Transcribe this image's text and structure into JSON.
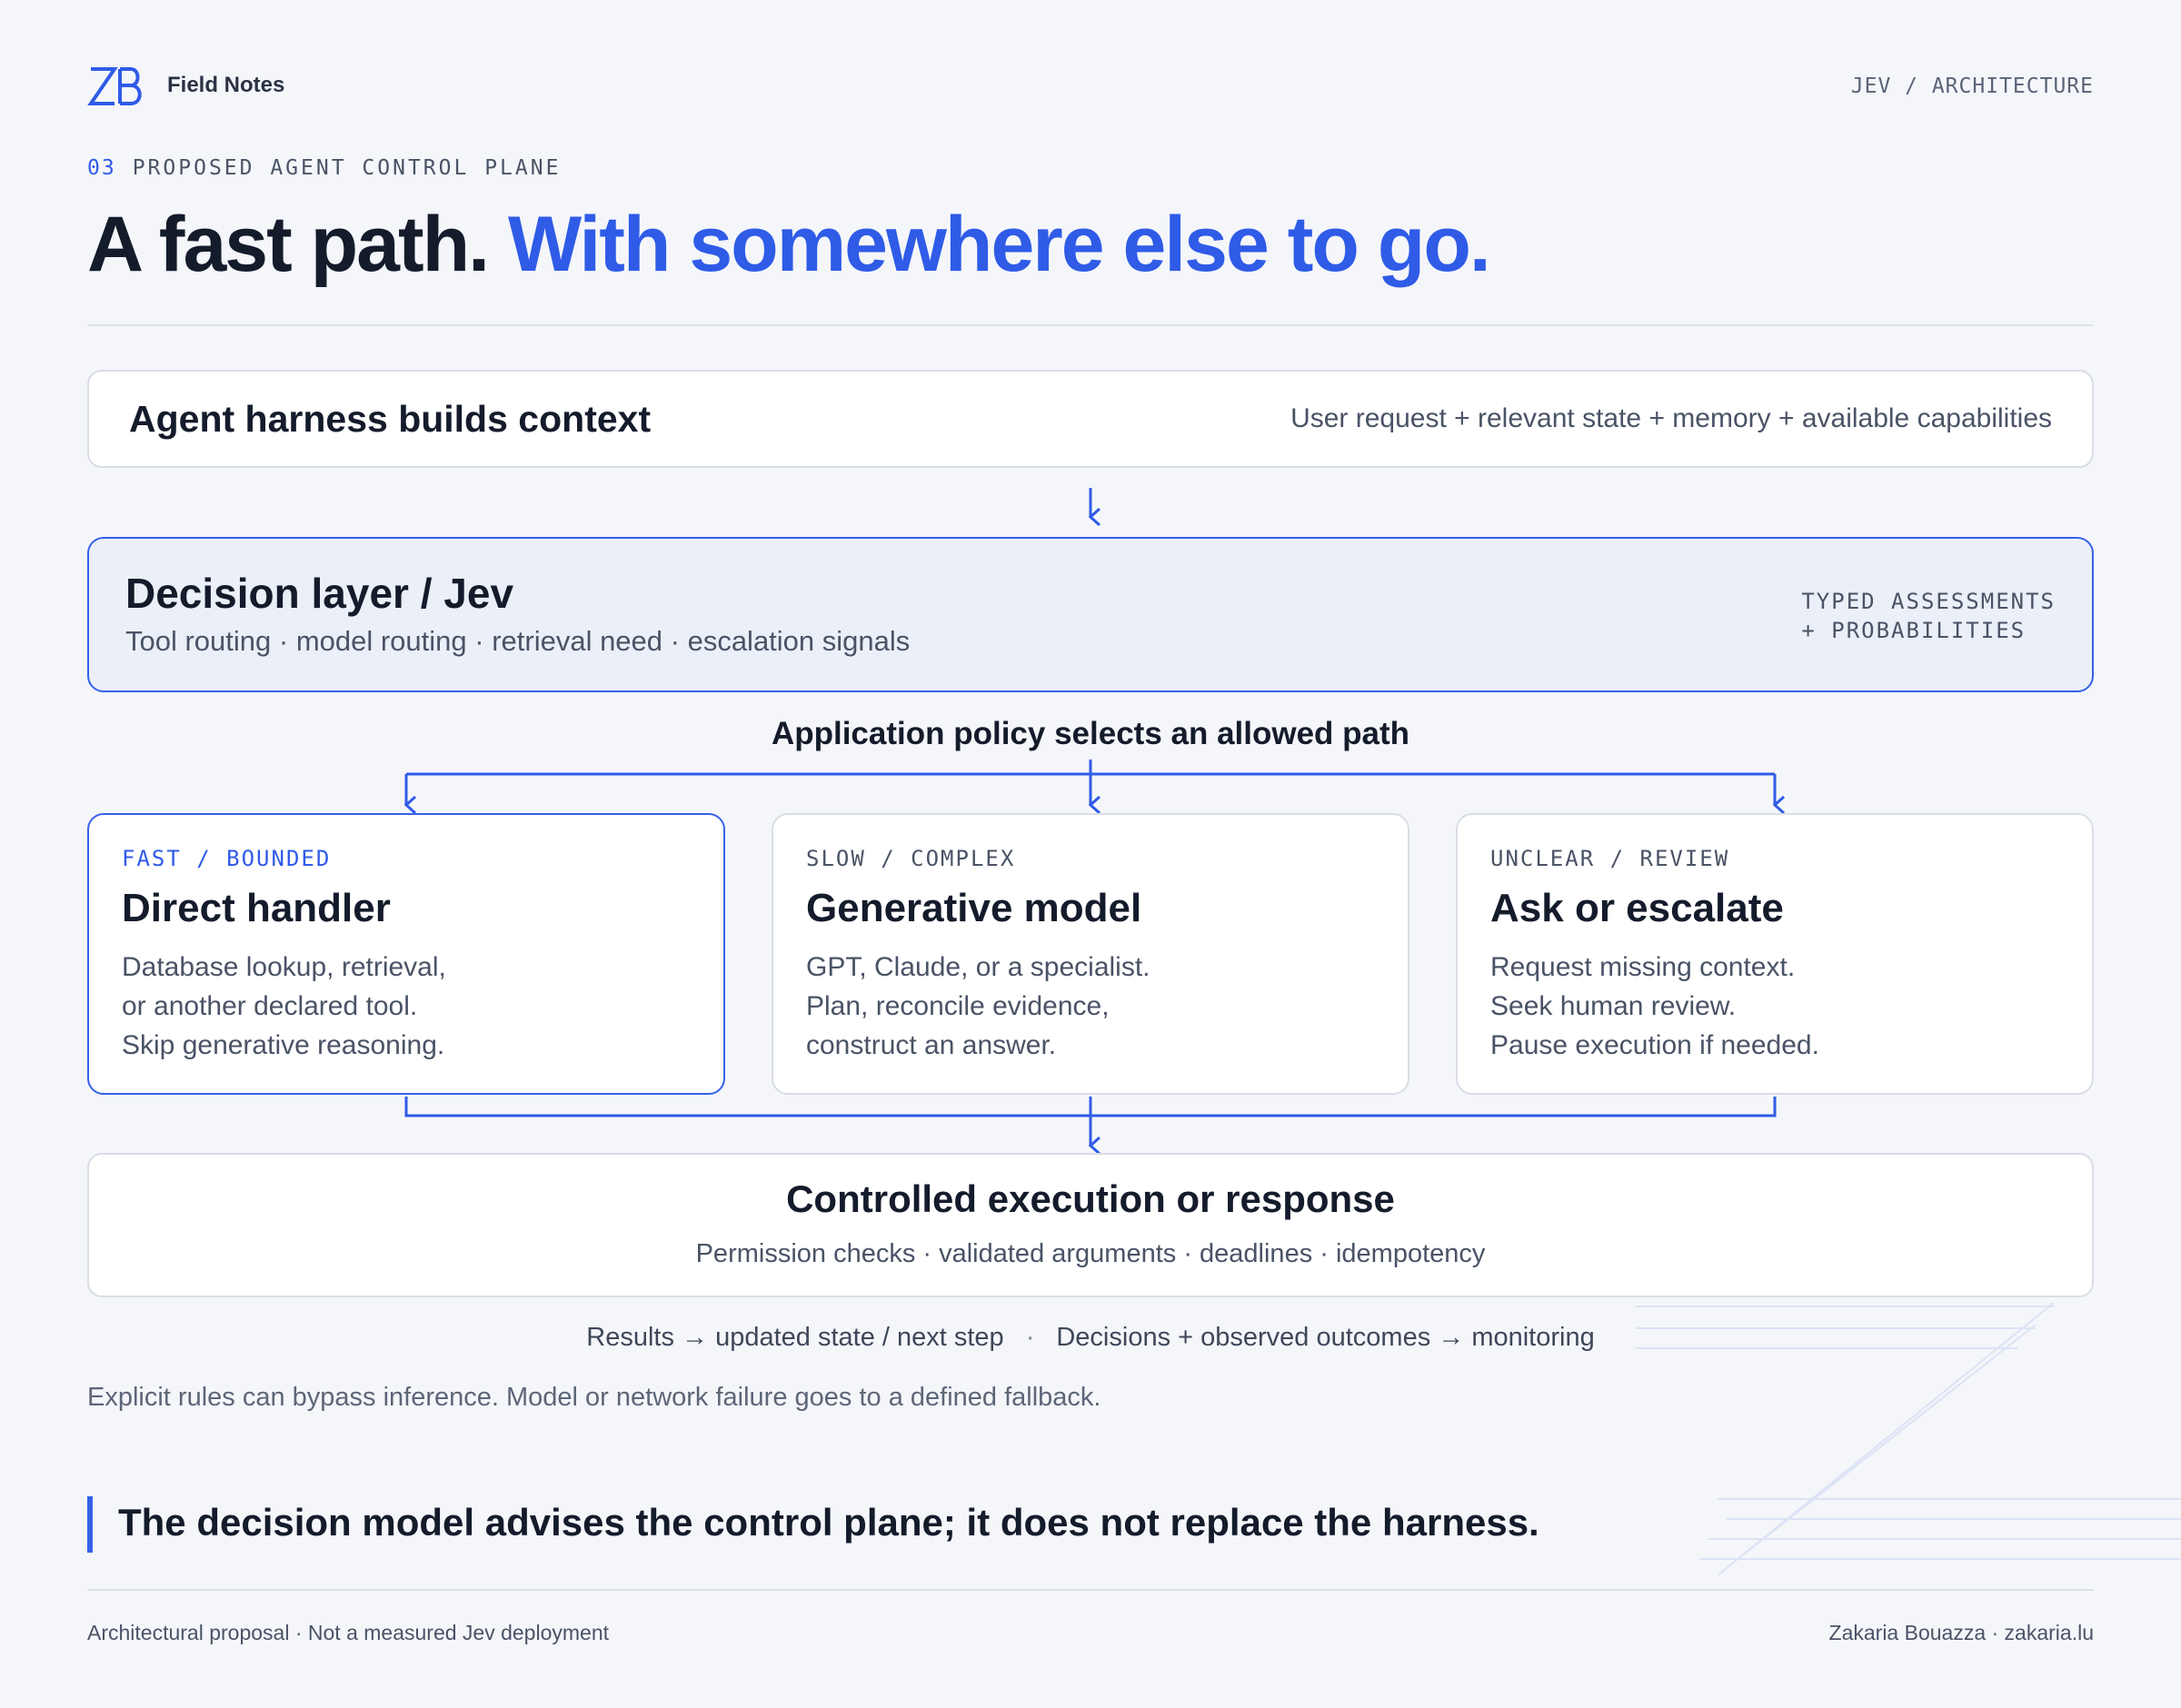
{
  "header": {
    "logo_text": "ZB",
    "brand": "Field Notes",
    "section_path": "JEV / ARCHITECTURE"
  },
  "eyebrow": {
    "number": "03",
    "label": "PROPOSED AGENT CONTROL PLANE"
  },
  "headline": {
    "lead": "A fast path.",
    "accent": "With somewhere else to go."
  },
  "context_box": {
    "title": "Agent harness builds context",
    "subtitle": "User request + relevant state + memory + available capabilities"
  },
  "decision_box": {
    "title": "Decision layer / Jev",
    "subtitle": "Tool routing · model routing · retrieval need · escalation signals",
    "tag_line1": "TYPED ASSESSMENTS",
    "tag_line2": "+ PROBABILITIES"
  },
  "policy_label": "Application policy selects an allowed path",
  "paths": [
    {
      "tag": "FAST / BOUNDED",
      "title": "Direct handler",
      "lines": [
        "Database lookup, retrieval,",
        "or another declared tool.",
        "Skip generative reasoning."
      ]
    },
    {
      "tag": "SLOW / COMPLEX",
      "title": "Generative model",
      "lines": [
        "GPT, Claude, or a specialist.",
        "Plan, reconcile evidence,",
        "construct an answer."
      ]
    },
    {
      "tag": "UNCLEAR / REVIEW",
      "title": "Ask or escalate",
      "lines": [
        "Request missing context.",
        "Seek human review.",
        "Pause execution if needed."
      ]
    }
  ],
  "execution_box": {
    "title": "Controlled execution or response",
    "subtitle": "Permission checks · validated arguments · deadlines · idempotency"
  },
  "outcomes": {
    "left": "Results → updated state / next step",
    "separator": "·",
    "right": "Decisions + observed outcomes → monitoring"
  },
  "note": "Explicit rules can bypass inference. Model or network failure goes to a defined fallback.",
  "quote": "The decision model advises the control plane; it does not replace the harness.",
  "footer": {
    "left": "Architectural proposal · Not a measured Jev deployment",
    "right": "Zakaria Bouazza · zakaria.lu"
  },
  "colors": {
    "accent": "#2f5be7",
    "ink": "#141b2b",
    "muted": "#4a5366",
    "background": "#f4f6fa"
  }
}
